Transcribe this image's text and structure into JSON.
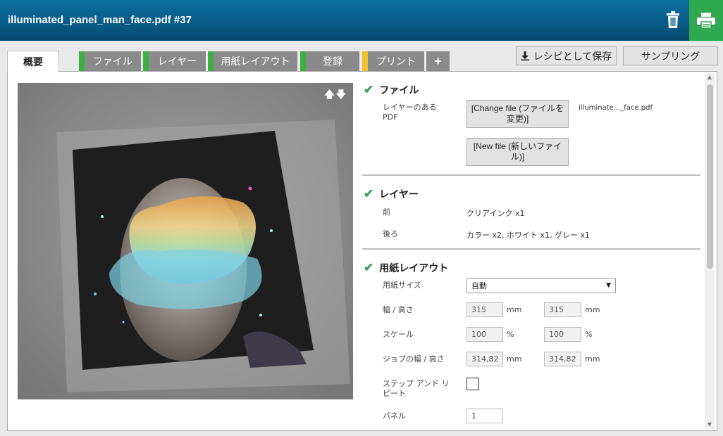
{
  "header": {
    "title": "illuminated_panel_man_face.pdf #37",
    "trash_icon": "trash-icon",
    "print_icon": "printer-icon",
    "print_bg": "#2fa84f"
  },
  "tabs": [
    {
      "label": "概要",
      "active": true
    },
    {
      "label": "ファイル",
      "status_color": "#3cb043"
    },
    {
      "label": "レイヤー",
      "status_color": "#3cb043"
    },
    {
      "label": "用紙レイアウト",
      "status_color": "#3cb043"
    },
    {
      "label": "登録",
      "status_color": "#3cb043"
    },
    {
      "label": "プリント",
      "status_color": "#f2c12e"
    },
    {
      "label": "+"
    }
  ],
  "actions": {
    "save_recipe": "レシピとして保存",
    "save_icon": "download-icon",
    "sampling": "サンプリング"
  },
  "preview": {
    "arrows": "🡅🡇",
    "description_icon": "image-preview"
  },
  "file_section": {
    "title": "ファイル",
    "layered_pdf_label": "レイヤーのある\nPDF",
    "change_file": "[Change file (ファイルを変更)]",
    "new_file": "[New file (新しいファイル)]",
    "filename": "illuminate..._face.pdf"
  },
  "layer_section": {
    "title": "レイヤー",
    "front_label": "前",
    "front_value": "クリアインク x1",
    "back_label": "後ろ",
    "back_value": "カラー x2, ホワイト x1, グレー x1"
  },
  "layout_section": {
    "title": "用紙レイアウト",
    "paper_size_label": "用紙サイズ",
    "paper_size_value": "自動",
    "wh_label": "幅 / 高さ",
    "width": "315",
    "height": "315",
    "unit_mm": "mm",
    "scale_label": "スケール",
    "scale_x": "100",
    "scale_y": "100",
    "unit_pct": "%",
    "job_wh_label": "ジョブの幅 / 高さ",
    "job_width": "314,82",
    "job_height": "314,82",
    "step_repeat_label": "ステップ アンド リ\nピート",
    "panel_label": "パネル",
    "panel_value": "1"
  }
}
